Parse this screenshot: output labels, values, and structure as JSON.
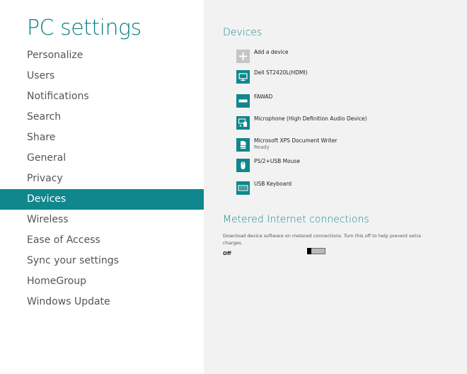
{
  "app": {
    "title": "PC settings"
  },
  "nav": {
    "items": [
      {
        "label": "Personalize"
      },
      {
        "label": "Users"
      },
      {
        "label": "Notifications"
      },
      {
        "label": "Search"
      },
      {
        "label": "Share"
      },
      {
        "label": "General"
      },
      {
        "label": "Privacy"
      },
      {
        "label": "Devices"
      },
      {
        "label": "Wireless"
      },
      {
        "label": "Ease of Access"
      },
      {
        "label": "Sync your settings"
      },
      {
        "label": "HomeGroup"
      },
      {
        "label": "Windows Update"
      }
    ],
    "selected": "Devices"
  },
  "devices": {
    "title": "Devices",
    "items": [
      {
        "name": "Add a device",
        "status": "",
        "icon": "plus-icon"
      },
      {
        "name": "Dell ST2420L(HDMI)",
        "status": "",
        "icon": "monitor-icon"
      },
      {
        "name": "FAWAD",
        "status": "",
        "icon": "computer-icon"
      },
      {
        "name": "Microphone (High Definition Audio Device)",
        "status": "",
        "icon": "microphone-device-icon"
      },
      {
        "name": "Microsoft XPS Document Writer",
        "status": "Ready",
        "icon": "printer-icon"
      },
      {
        "name": "PS/2+USB Mouse",
        "status": "",
        "icon": "mouse-icon"
      },
      {
        "name": "USB Keyboard",
        "status": "",
        "icon": "keyboard-icon"
      }
    ]
  },
  "metered": {
    "title": "Metered Internet connections",
    "description": "Download device software on metered connections. Turn this off to help prevent extra charges.",
    "toggle_label": "Off",
    "toggle_on": false
  },
  "colors": {
    "accent": "#0f878c",
    "title": "#0a7e7e",
    "right_pane_bg": "#f2f2f2",
    "add_icon_bg": "#c5c5c5"
  }
}
